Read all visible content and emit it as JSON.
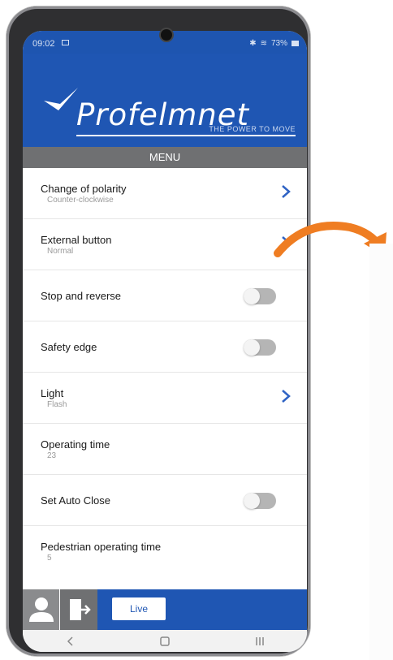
{
  "status": {
    "time": "09:02",
    "battery": "73%"
  },
  "brand": {
    "name": "Profelmnet",
    "tagline": "THE POWER TO MOVE"
  },
  "menu_title": "MENU",
  "items": [
    {
      "title": "Change of polarity",
      "subtitle": "Counter-clockwise",
      "control": "chevron"
    },
    {
      "title": "External button",
      "subtitle": "Normal",
      "control": "chevron"
    },
    {
      "title": "Stop and reverse",
      "control": "toggle",
      "state": "off"
    },
    {
      "title": "Safety edge",
      "control": "toggle",
      "state": "off"
    },
    {
      "title": "Light",
      "subtitle": "Flash",
      "control": "chevron"
    },
    {
      "title": "Operating time",
      "subtitle": "23",
      "control": "none"
    },
    {
      "title": "Set Auto Close",
      "control": "toggle",
      "state": "off"
    },
    {
      "title": "Pedestrian operating time",
      "subtitle": "5",
      "control": "none"
    }
  ],
  "bottom": {
    "live_label": "Live"
  },
  "colors": {
    "brand_blue": "#1f56b3",
    "menu_gray": "#6f7072",
    "arrow_orange": "#ef7d22",
    "chevron_blue": "#2f63c4"
  }
}
